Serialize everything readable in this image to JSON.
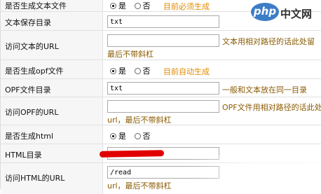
{
  "watermark": {
    "badge": "php",
    "text": "中文网"
  },
  "rows": [
    {
      "label": "是否生成文本文件",
      "radio": {
        "yes": "是",
        "no": "否",
        "selected": "yes"
      },
      "hint": "目前必须生成"
    },
    {
      "label": "文本保存目录",
      "field_value": "txt"
    },
    {
      "label": "访问文本的URL",
      "field_value": "",
      "hint_right": "文本用相对路径的话此处留",
      "hint_below": "最后不带斜杠"
    },
    {
      "label": "是否生成opf文件",
      "radio": {
        "yes": "是",
        "no": "否",
        "selected": "yes"
      },
      "hint": "目前自动生成"
    },
    {
      "label": "OPF文件目录",
      "field_value": "txt",
      "hint_right": "一般和文本放在同一目录"
    },
    {
      "label": "访问OPF的URL",
      "field_value": "",
      "hint_right": "OPF文件用相对路径的话此处",
      "hint_below": "url，最后不带斜杠"
    },
    {
      "label": "是否生成html",
      "radio": {
        "yes": "是",
        "no": "否",
        "selected": "yes"
      }
    },
    {
      "label": "HTML目录",
      "field_value": ""
    },
    {
      "label": "访问HTML的URL",
      "field_value": "/read",
      "hint_below": "url，最后不带斜杠"
    }
  ]
}
